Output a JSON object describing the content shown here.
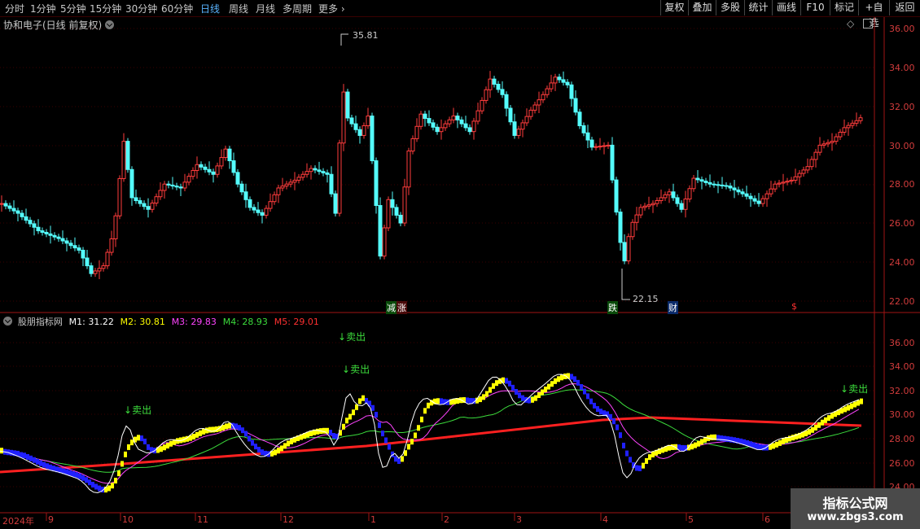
{
  "periods": [
    "分时",
    "1分钟",
    "5分钟",
    "15分钟",
    "30分钟",
    "60分钟",
    "日线",
    "周线",
    "月线",
    "多周期",
    "更多"
  ],
  "active_period": "日线",
  "tools": [
    "复权",
    "叠加",
    "多股",
    "统计",
    "画线",
    "F10",
    "标记",
    "+自选",
    "返回"
  ],
  "main_panel": {
    "title": "协和电子(日线 前复权)",
    "price_labels": [
      "36.00",
      "34.00",
      "32.00",
      "30.00",
      "28.00",
      "26.00",
      "24.00",
      "22.00"
    ],
    "high_label": "35.81",
    "low_label": "22.15",
    "event_marks": [
      "减",
      "涨",
      "跌",
      "财",
      "$"
    ]
  },
  "indicator_panel": {
    "name": "股朋指标网",
    "items": [
      {
        "label": "M1: 31.22",
        "color": "#ffffff"
      },
      {
        "label": "M2: 30.81",
        "color": "#ffff00"
      },
      {
        "label": "M3: 29.83",
        "color": "#ff44ff"
      },
      {
        "label": "M4: 28.93",
        "color": "#3cdc3c"
      },
      {
        "label": "M5: 29.01",
        "color": "#ff3030"
      }
    ],
    "price_labels": [
      "36.00",
      "34.00",
      "32.00",
      "30.00",
      "28.00",
      "26.00",
      "24.00"
    ],
    "signals": [
      "卖出",
      "卖出",
      "卖出",
      "卖出"
    ]
  },
  "x_axis": [
    "2024年",
    "9",
    "10",
    "11",
    "12",
    "1",
    "2",
    "3",
    "4",
    "5",
    "6"
  ],
  "watermark": {
    "line1": "指标公式网",
    "line2": "www.zbgs3.com"
  }
}
